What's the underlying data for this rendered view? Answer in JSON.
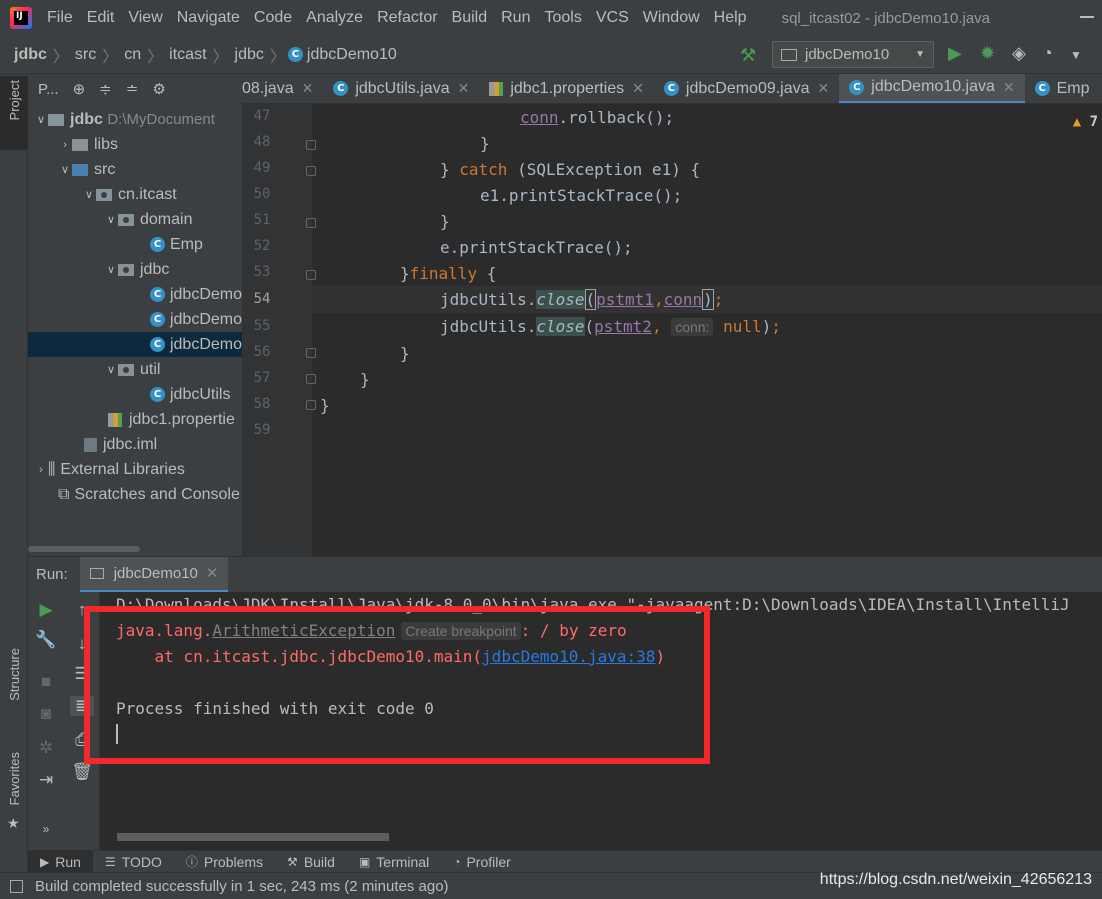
{
  "menu": [
    "File",
    "Edit",
    "View",
    "Navigate",
    "Code",
    "Analyze",
    "Refactor",
    "Build",
    "Run",
    "Tools",
    "VCS",
    "Window",
    "Help"
  ],
  "window_title": "sql_itcast02 - jdbcDemo10.java",
  "breadcrumb": [
    "jdbc",
    "src",
    "cn",
    "itcast",
    "jdbc",
    "jdbcDemo10"
  ],
  "run_config": "jdbcDemo10",
  "project_panel": {
    "title": "P...",
    "tree": [
      {
        "label": "jdbc",
        "extra": "D:\\MyDocument"
      },
      {
        "label": "libs"
      },
      {
        "label": "src"
      },
      {
        "label": "cn.itcast"
      },
      {
        "label": "domain"
      },
      {
        "label": "Emp"
      },
      {
        "label": "jdbc"
      },
      {
        "label": "jdbcDemo"
      },
      {
        "label": "jdbcDemo"
      },
      {
        "label": "jdbcDemo"
      },
      {
        "label": "util"
      },
      {
        "label": "jdbcUtils"
      },
      {
        "label": "jdbc1.propertie"
      },
      {
        "label": "jdbc.iml"
      },
      {
        "label": "External Libraries"
      },
      {
        "label": "Scratches and Console"
      }
    ]
  },
  "tabs": [
    {
      "label": "08.java"
    },
    {
      "label": "jdbcUtils.java"
    },
    {
      "label": "jdbc1.properties"
    },
    {
      "label": "jdbcDemo09.java"
    },
    {
      "label": "jdbcDemo10.java"
    },
    {
      "label": "Emp"
    }
  ],
  "editor": {
    "line_numbers": [
      "47",
      "48",
      "49",
      "50",
      "51",
      "52",
      "53",
      "54",
      "55",
      "56",
      "57",
      "58",
      "59"
    ],
    "warning_count": "7",
    "lines": {
      "l47": {
        "a": "conn",
        ".rollback();": ".rollback();"
      },
      "l47_text": ".rollback();",
      "l48": "}",
      "l49_a": "} ",
      "l49_kw": "catch",
      "l49_b": " (SQLException e1) {",
      "l50": "e1.printStackTrace();",
      "l51": "}",
      "l52": "e.printStackTrace();",
      "l53_a": "}",
      "l53_kw": "finally",
      "l53_b": " {",
      "l54_a": "jdbcUtils.",
      "l54_m": "close",
      "l54_p1": "pstmt1",
      "l54_p2": "conn",
      "l55_a": "jdbcUtils.",
      "l55_m": "close",
      "l55_p1": "pstmt2",
      "l55_hint": "conn:",
      "l55_null": "null",
      "l56": "}",
      "l57": "}",
      "l58": "}"
    }
  },
  "run_panel": {
    "label": "Run:",
    "tab": "jdbcDemo10",
    "console": {
      "cmd": "D:\\Downloads\\JDK\\Install\\Java\\jdk-8.0_0\\bin\\java.exe \"-javaagent:D:\\Downloads\\IDEA\\Install\\IntelliJ",
      "exc_pkg": "java.lang.",
      "exc_name": "ArithmeticException",
      "hint": "Create breakpoint",
      "exc_msg": ": / by zero",
      "at": "    at cn.itcast.jdbc.jdbcDemo10.main(",
      "at_link": "jdbcDemo10.java:38",
      "at_end": ")",
      "finished": "Process finished with exit code 0"
    }
  },
  "bottom_tools": [
    "Run",
    "TODO",
    "Problems",
    "Build",
    "Terminal",
    "Profiler"
  ],
  "side_tabs": {
    "project": "Project",
    "structure": "Structure",
    "favorites": "Favorites"
  },
  "status": "Build completed successfully in 1 sec, 243 ms (2 minutes ago)",
  "watermark": "https://blog.csdn.net/weixin_42656213",
  "colors": {
    "accent": "#4a88c7",
    "error": "#ff6b68",
    "highlight_box": "#f2292a"
  }
}
